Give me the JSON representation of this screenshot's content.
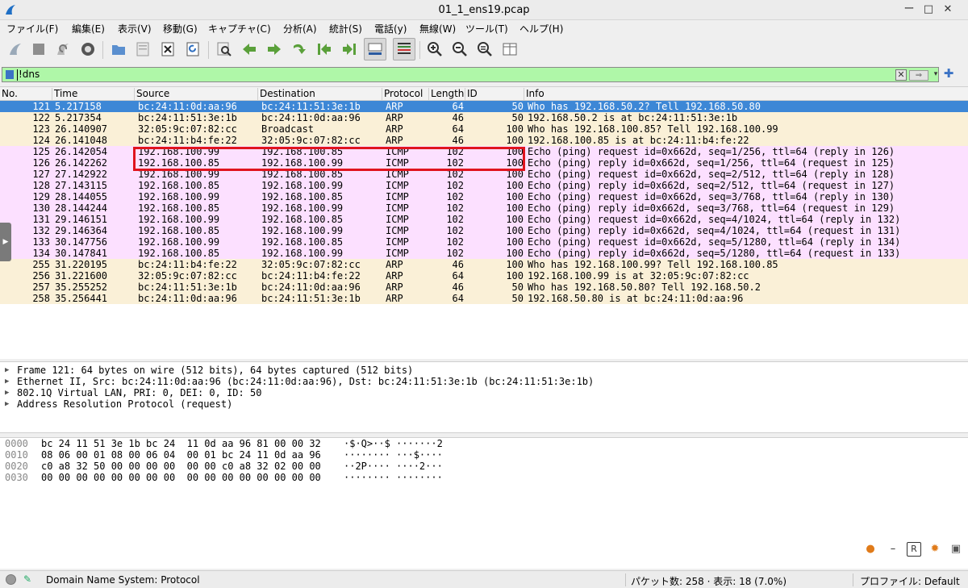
{
  "window": {
    "title": "01_1_ens19.pcap",
    "minimize": "ー",
    "maximize": "□",
    "close": "✕"
  },
  "menu": [
    "ファイル(F)",
    "編集(E)",
    "表示(V)",
    "移動(G)",
    "キャプチャ(C)",
    "分析(A)",
    "統計(S)",
    "電話(y)",
    "無線(W)",
    "ツール(T)",
    "ヘルプ(H)"
  ],
  "filter": {
    "value": "!dns",
    "clear": "✕",
    "apply": "⇒",
    "dropdown": "▾",
    "add": "✚"
  },
  "columns": [
    "No.",
    "Time",
    "Source",
    "Destination",
    "Protocol",
    "Length",
    "ID",
    "Info"
  ],
  "packets": [
    {
      "no": "121",
      "time": "5.217158",
      "src": "bc:24:11:0d:aa:96",
      "dst": "bc:24:11:51:3e:1b",
      "proto": "ARP",
      "len": "64",
      "id": "50",
      "info": "Who has 192.168.50.2? Tell 192.168.50.80",
      "kind": "selected"
    },
    {
      "no": "122",
      "time": "5.217354",
      "src": "bc:24:11:51:3e:1b",
      "dst": "bc:24:11:0d:aa:96",
      "proto": "ARP",
      "len": "46",
      "id": "50",
      "info": "192.168.50.2 is at bc:24:11:51:3e:1b",
      "kind": "arp"
    },
    {
      "no": "123",
      "time": "26.140907",
      "src": "32:05:9c:07:82:cc",
      "dst": "Broadcast",
      "proto": "ARP",
      "len": "64",
      "id": "100",
      "info": "Who has 192.168.100.85? Tell 192.168.100.99",
      "kind": "arp"
    },
    {
      "no": "124",
      "time": "26.141048",
      "src": "bc:24:11:b4:fe:22",
      "dst": "32:05:9c:07:82:cc",
      "proto": "ARP",
      "len": "46",
      "id": "100",
      "info": "192.168.100.85 is at bc:24:11:b4:fe:22",
      "kind": "arp"
    },
    {
      "no": "125",
      "time": "26.142054",
      "src": "192.168.100.99",
      "dst": "192.168.100.85",
      "proto": "ICMP",
      "len": "102",
      "id": "100",
      "info": "Echo (ping) request  id=0x662d, seq=1/256, ttl=64 (reply in 126)",
      "kind": "icmp"
    },
    {
      "no": "126",
      "time": "26.142262",
      "src": "192.168.100.85",
      "dst": "192.168.100.99",
      "proto": "ICMP",
      "len": "102",
      "id": "100",
      "info": "Echo (ping) reply    id=0x662d, seq=1/256, ttl=64 (request in 125)",
      "kind": "icmp"
    },
    {
      "no": "127",
      "time": "27.142922",
      "src": "192.168.100.99",
      "dst": "192.168.100.85",
      "proto": "ICMP",
      "len": "102",
      "id": "100",
      "info": "Echo (ping) request  id=0x662d, seq=2/512, ttl=64 (reply in 128)",
      "kind": "icmp"
    },
    {
      "no": "128",
      "time": "27.143115",
      "src": "192.168.100.85",
      "dst": "192.168.100.99",
      "proto": "ICMP",
      "len": "102",
      "id": "100",
      "info": "Echo (ping) reply    id=0x662d, seq=2/512, ttl=64 (request in 127)",
      "kind": "icmp"
    },
    {
      "no": "129",
      "time": "28.144055",
      "src": "192.168.100.99",
      "dst": "192.168.100.85",
      "proto": "ICMP",
      "len": "102",
      "id": "100",
      "info": "Echo (ping) request  id=0x662d, seq=3/768, ttl=64 (reply in 130)",
      "kind": "icmp"
    },
    {
      "no": "130",
      "time": "28.144244",
      "src": "192.168.100.85",
      "dst": "192.168.100.99",
      "proto": "ICMP",
      "len": "102",
      "id": "100",
      "info": "Echo (ping) reply    id=0x662d, seq=3/768, ttl=64 (request in 129)",
      "kind": "icmp"
    },
    {
      "no": "131",
      "time": "29.146151",
      "src": "192.168.100.99",
      "dst": "192.168.100.85",
      "proto": "ICMP",
      "len": "102",
      "id": "100",
      "info": "Echo (ping) request  id=0x662d, seq=4/1024, ttl=64 (reply in 132)",
      "kind": "icmp"
    },
    {
      "no": "132",
      "time": "29.146364",
      "src": "192.168.100.85",
      "dst": "192.168.100.99",
      "proto": "ICMP",
      "len": "102",
      "id": "100",
      "info": "Echo (ping) reply    id=0x662d, seq=4/1024, ttl=64 (request in 131)",
      "kind": "icmp"
    },
    {
      "no": "133",
      "time": "30.147756",
      "src": "192.168.100.99",
      "dst": "192.168.100.85",
      "proto": "ICMP",
      "len": "102",
      "id": "100",
      "info": "Echo (ping) request  id=0x662d, seq=5/1280, ttl=64 (reply in 134)",
      "kind": "icmp"
    },
    {
      "no": "134",
      "time": "30.147841",
      "src": "192.168.100.85",
      "dst": "192.168.100.99",
      "proto": "ICMP",
      "len": "102",
      "id": "100",
      "info": "Echo (ping) reply    id=0x662d, seq=5/1280, ttl=64 (request in 133)",
      "kind": "icmp"
    },
    {
      "no": "255",
      "time": "31.220195",
      "src": "bc:24:11:b4:fe:22",
      "dst": "32:05:9c:07:82:cc",
      "proto": "ARP",
      "len": "46",
      "id": "100",
      "info": "Who has 192.168.100.99? Tell 192.168.100.85",
      "kind": "arp"
    },
    {
      "no": "256",
      "time": "31.221600",
      "src": "32:05:9c:07:82:cc",
      "dst": "bc:24:11:b4:fe:22",
      "proto": "ARP",
      "len": "64",
      "id": "100",
      "info": "192.168.100.99 is at 32:05:9c:07:82:cc",
      "kind": "arp"
    },
    {
      "no": "257",
      "time": "35.255252",
      "src": "bc:24:11:51:3e:1b",
      "dst": "bc:24:11:0d:aa:96",
      "proto": "ARP",
      "len": "46",
      "id": "50",
      "info": "Who has 192.168.50.80? Tell 192.168.50.2",
      "kind": "arp"
    },
    {
      "no": "258",
      "time": "35.256441",
      "src": "bc:24:11:0d:aa:96",
      "dst": "bc:24:11:51:3e:1b",
      "proto": "ARP",
      "len": "64",
      "id": "50",
      "info": "192.168.50.80 is at bc:24:11:0d:aa:96",
      "kind": "arp"
    }
  ],
  "details": [
    "Frame 121: 64 bytes on wire (512 bits), 64 bytes captured (512 bits)",
    "Ethernet II, Src: bc:24:11:0d:aa:96 (bc:24:11:0d:aa:96), Dst: bc:24:11:51:3e:1b (bc:24:11:51:3e:1b)",
    "802.1Q Virtual LAN, PRI: 0, DEI: 0, ID: 50",
    "Address Resolution Protocol (request)"
  ],
  "bytes": [
    {
      "offset": "0000",
      "hex": "bc 24 11 51 3e 1b bc 24  11 0d aa 96 81 00 00 32",
      "ascii": "·$·Q>··$ ·······2"
    },
    {
      "offset": "0010",
      "hex": "08 06 00 01 08 00 06 04  00 01 bc 24 11 0d aa 96",
      "ascii": "········ ···$····"
    },
    {
      "offset": "0020",
      "hex": "c0 a8 32 50 00 00 00 00  00 00 c0 a8 32 02 00 00",
      "ascii": "··2P···· ····2···"
    },
    {
      "offset": "0030",
      "hex": "00 00 00 00 00 00 00 00  00 00 00 00 00 00 00 00",
      "ascii": "········ ········"
    }
  ],
  "status": {
    "protocol": "Domain Name System: Protocol",
    "packets": "パケット数: 258 · 表示: 18 (7.0%)",
    "profile": "プロファイル: Default"
  },
  "colors": {
    "arp": "#faf0d7",
    "icmp": "#fce0ff",
    "selected": "#3d87d6",
    "filter_ok": "#aff7a8",
    "highlight": "#e0141e"
  }
}
